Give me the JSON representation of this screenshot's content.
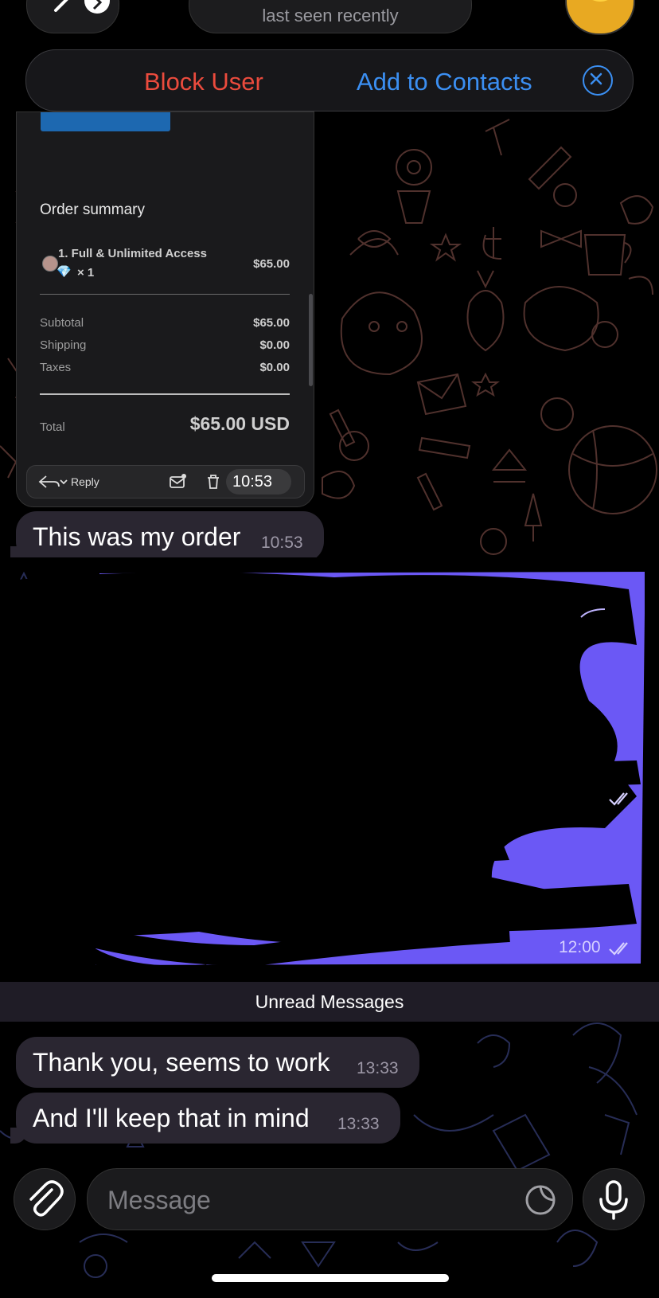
{
  "header": {
    "status": "last seen recently"
  },
  "action_bar": {
    "block_label": "Block User",
    "add_label": "Add to Contacts"
  },
  "order_card": {
    "title": "Order summary",
    "item_name": "1. Full & Unlimited Access",
    "item_gem": "💎",
    "item_qty": "× 1",
    "item_price": "$65.00",
    "subtotal_label": "Subtotal",
    "subtotal_value": "$65.00",
    "shipping_label": "Shipping",
    "shipping_value": "$0.00",
    "taxes_label": "Taxes",
    "taxes_value": "$0.00",
    "total_label": "Total",
    "total_value": "$65.00 USD",
    "toolbar_reply": "Reply",
    "time": "10:53"
  },
  "messages": [
    {
      "text": "This was my order",
      "time": "10:53"
    },
    {
      "text": "Thank you, seems to work",
      "time": "13:33"
    },
    {
      "text": "And I'll keep that in mind",
      "time": "13:33"
    }
  ],
  "outgoing_time": "12:00",
  "unread_label": "Unread Messages",
  "composer": {
    "placeholder": "Message"
  },
  "icons": [
    "back-chevron-icon",
    "close-icon",
    "reply-icon",
    "mail-icon",
    "trash-icon",
    "double-check-icon",
    "paperclip-icon",
    "sticker-icon",
    "microphone-icon"
  ],
  "colors": {
    "block": "#eb4b3d",
    "accent": "#3b8ff2",
    "outgoing": "#6b58f5",
    "incoming": "#2a2631"
  }
}
